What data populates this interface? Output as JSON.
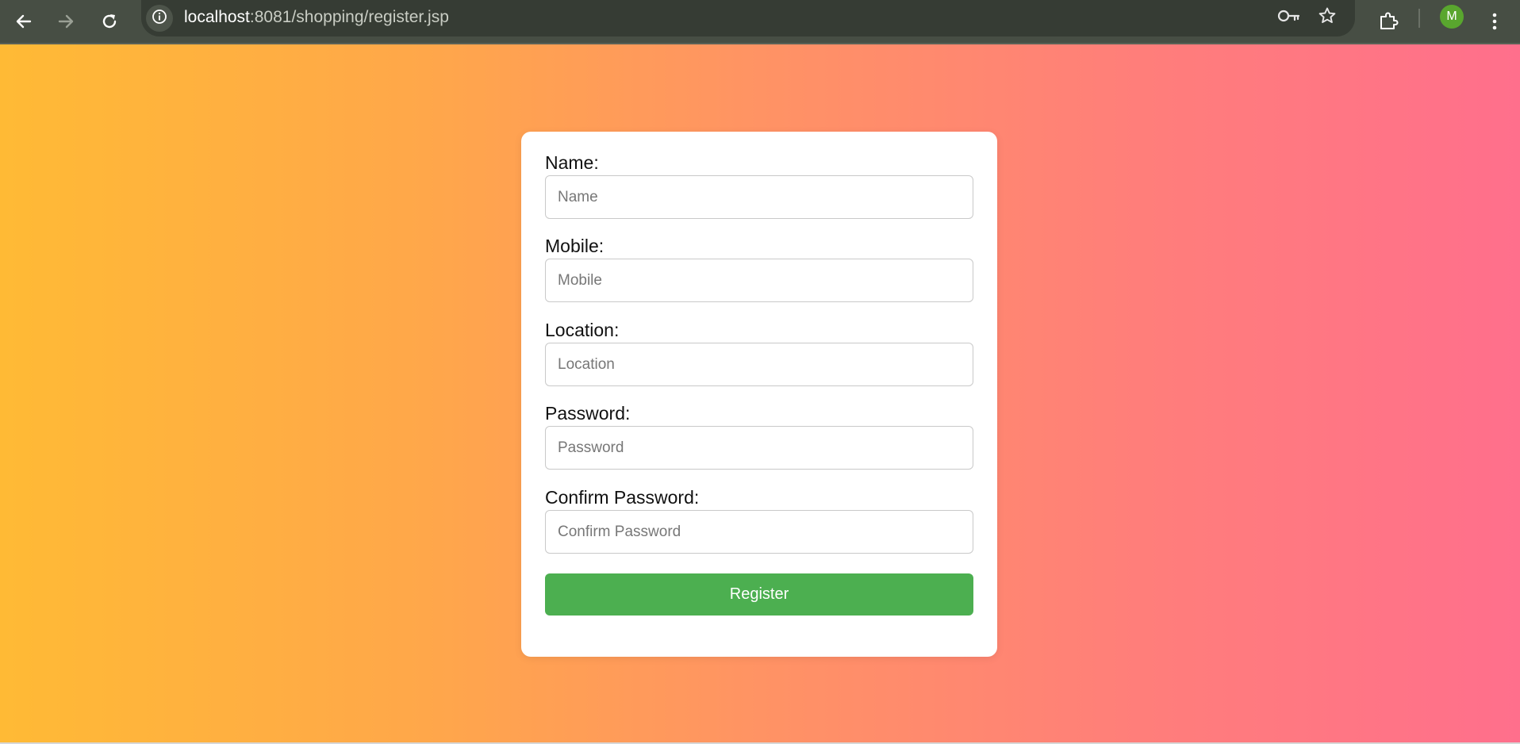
{
  "browser": {
    "url_host": "localhost",
    "url_rest": ":8081/shopping/register.jsp",
    "profile_initial": "M"
  },
  "form": {
    "fields": [
      {
        "label": "Name:",
        "placeholder": "Name"
      },
      {
        "label": "Mobile:",
        "placeholder": "Mobile"
      },
      {
        "label": "Location:",
        "placeholder": "Location"
      },
      {
        "label": "Password:",
        "placeholder": "Password"
      },
      {
        "label": "Confirm Password:",
        "placeholder": "Confirm Password"
      }
    ],
    "submit_label": "Register"
  },
  "colors": {
    "gradient_left": "#ffba35",
    "gradient_right": "#ff6f8c",
    "button": "#4caf50",
    "card": "#ffffff"
  }
}
